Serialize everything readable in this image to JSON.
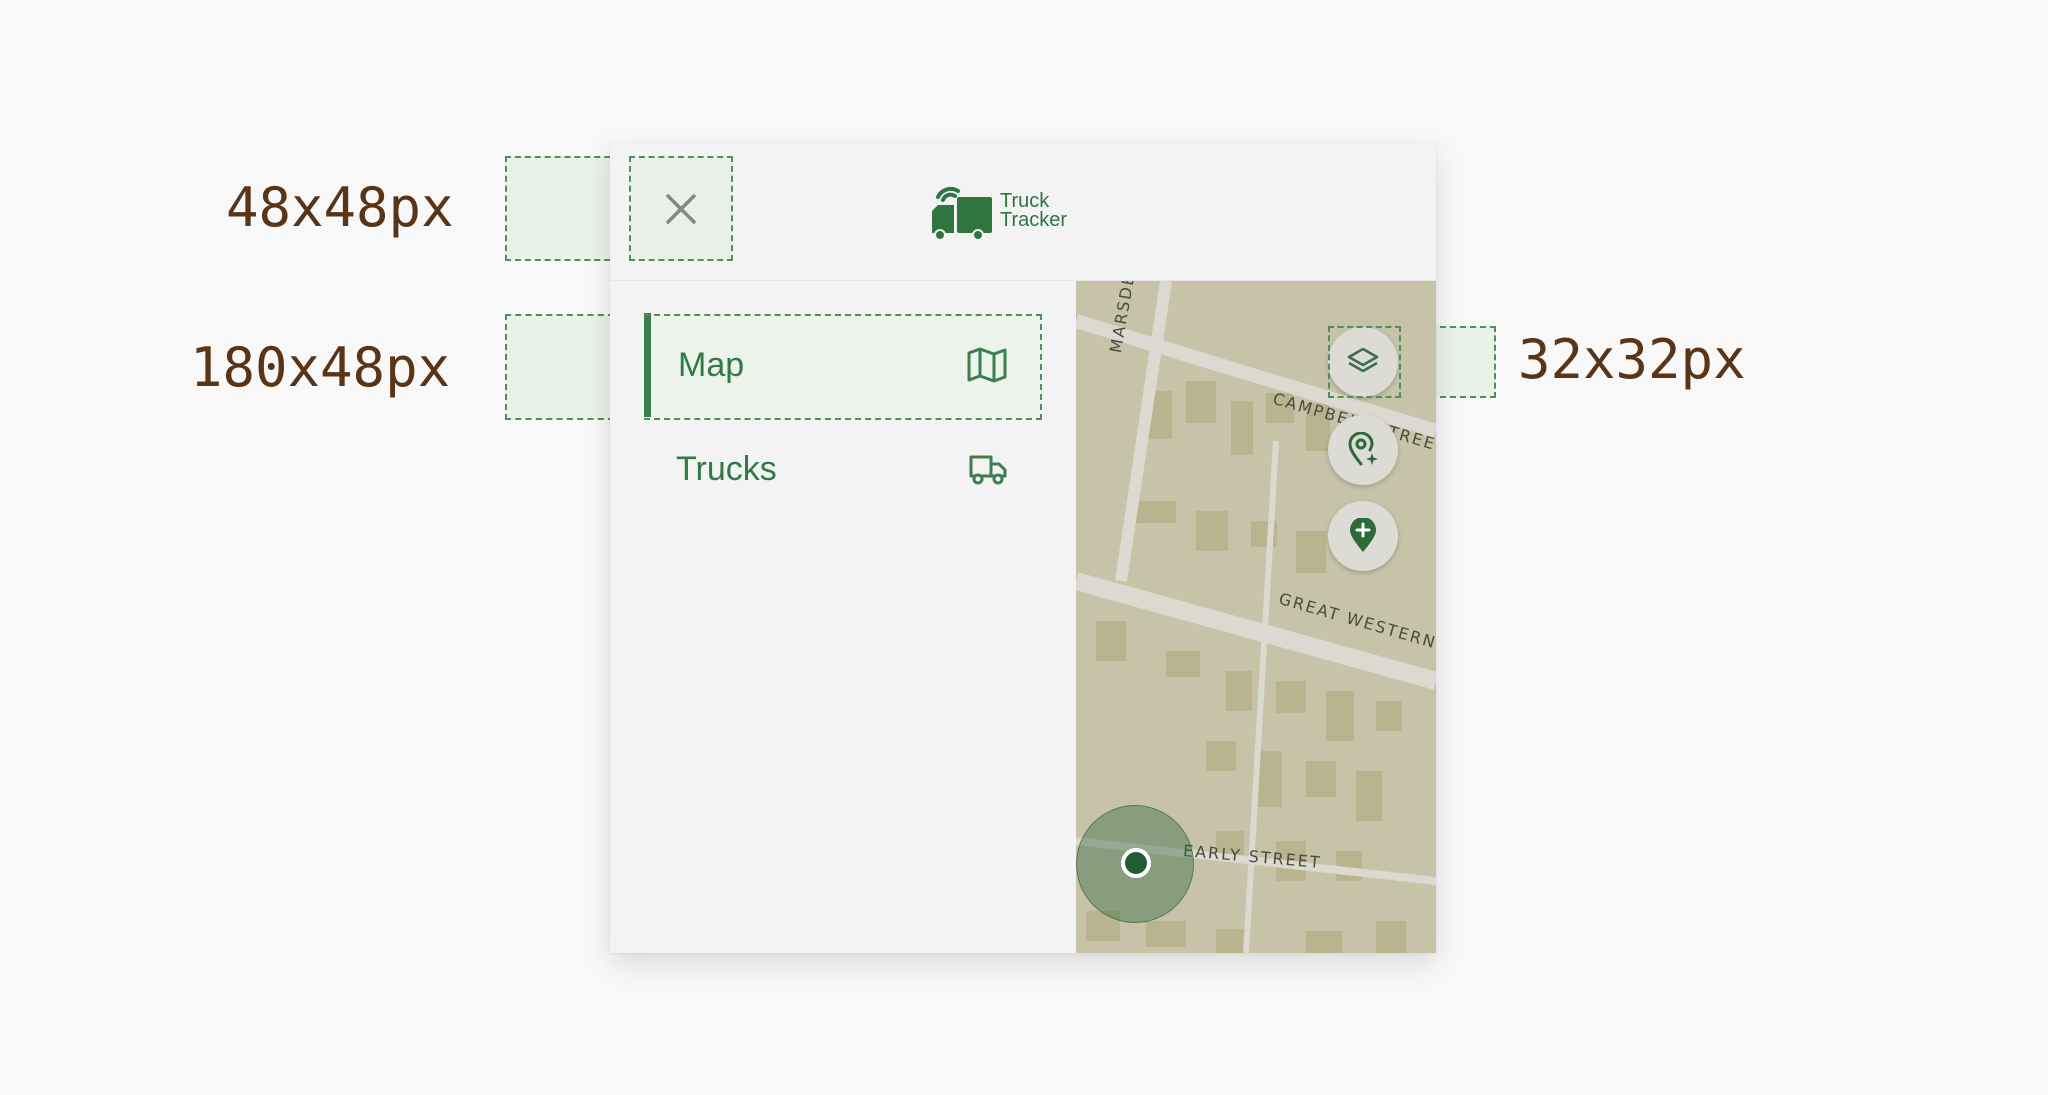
{
  "annotations": {
    "close_size": "48x48px",
    "nav_size": "180x48px",
    "map_button_size": "32x32px"
  },
  "header": {
    "logo_line1": "Truck",
    "logo_line2": "Tracker",
    "close_icon": "close-icon"
  },
  "nav": {
    "items": [
      {
        "label": "Map",
        "icon": "map-icon",
        "active": true
      },
      {
        "label": "Trucks",
        "icon": "truck-icon",
        "active": false
      }
    ]
  },
  "map": {
    "streets": {
      "marsden": "MARSDEN STRE",
      "campbell": "CAMPBELL STREET",
      "great_western": "GREAT WESTERN H",
      "early": "EARLY STREET"
    },
    "buttons": [
      "layers-icon",
      "location-sparkle-icon",
      "add-location-icon"
    ]
  },
  "colors": {
    "brand_green": "#2e7540",
    "annotation_text": "#5a3416",
    "map_base": "#c7c3a9"
  }
}
